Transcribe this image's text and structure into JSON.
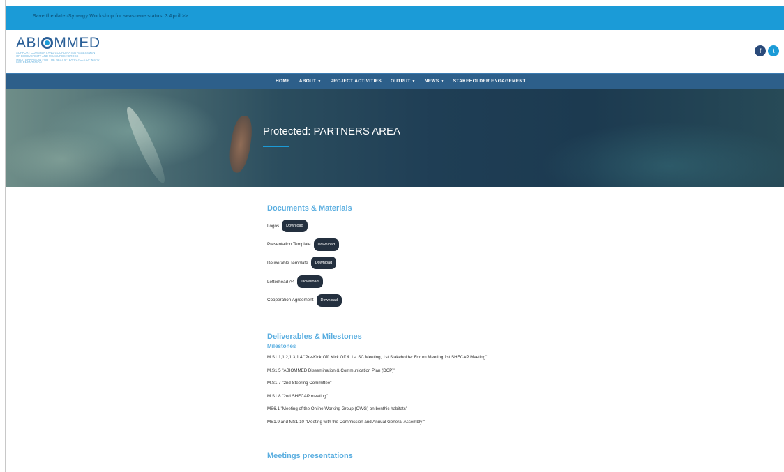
{
  "announcement": "Save the date -Synergy Workshop for seascene status, 3 April >>",
  "logo": {
    "prefix": "ABI",
    "suffix": "MMED",
    "tagline": "Support coherent and coordinated assessment of biodiversity and measures across Mediterranean for the next 6-year cycle of MSFD implementation"
  },
  "social": {
    "facebook": "f",
    "twitter": "t"
  },
  "nav": [
    {
      "label": "HOME",
      "dropdown": false
    },
    {
      "label": "ABOUT",
      "dropdown": true
    },
    {
      "label": "PROJECT ACTIVITIES",
      "dropdown": false
    },
    {
      "label": "OUTPUT",
      "dropdown": true
    },
    {
      "label": "NEWS",
      "dropdown": true
    },
    {
      "label": "STAKEHOLDER ENGAGEMENT",
      "dropdown": false
    }
  ],
  "hero": {
    "title": "Protected: PARTNERS AREA"
  },
  "documents": {
    "title": "Documents & Materials",
    "items": [
      {
        "label": "Logos",
        "button": "Download"
      },
      {
        "label": "Presentation Template",
        "button": "Download"
      },
      {
        "label": "Deliverable Template",
        "button": "Download"
      },
      {
        "label": "Letterhead A4",
        "button": "Download"
      },
      {
        "label": "Cooperation Agreement",
        "button": "Download"
      }
    ]
  },
  "deliverables": {
    "title": "Deliverables & Milestones",
    "subtitle": "Milestones",
    "items": [
      "M.S1.1,1.2,1.3,1.4 \"Pre-Kick Off, Kick Off & 1st SC Meeting, 1st Stakeholder Forum Meeting,1st SHECAP Meeting\"",
      "M.S1.5 \"ABIOMMED Dissemination & Communication Plan (DCP)\"",
      "M.S1.7 \"2nd Steering Committee\"",
      "M.S1.8 \"2nd SHECAP meeting\"",
      "MS6.1 \"Meeting of the Online Working Group (OWG) on benthic habitats\"",
      "MS1.9 and MS1.10 \"Meeting with the Commission and Anuual General Assembly \""
    ]
  },
  "meetings": {
    "title": "Meetings presentations"
  },
  "colors": {
    "topbar": "#1b9bd7",
    "nav": "#2d5f8a",
    "accent": "#5aaee0",
    "button": "#24303f"
  }
}
